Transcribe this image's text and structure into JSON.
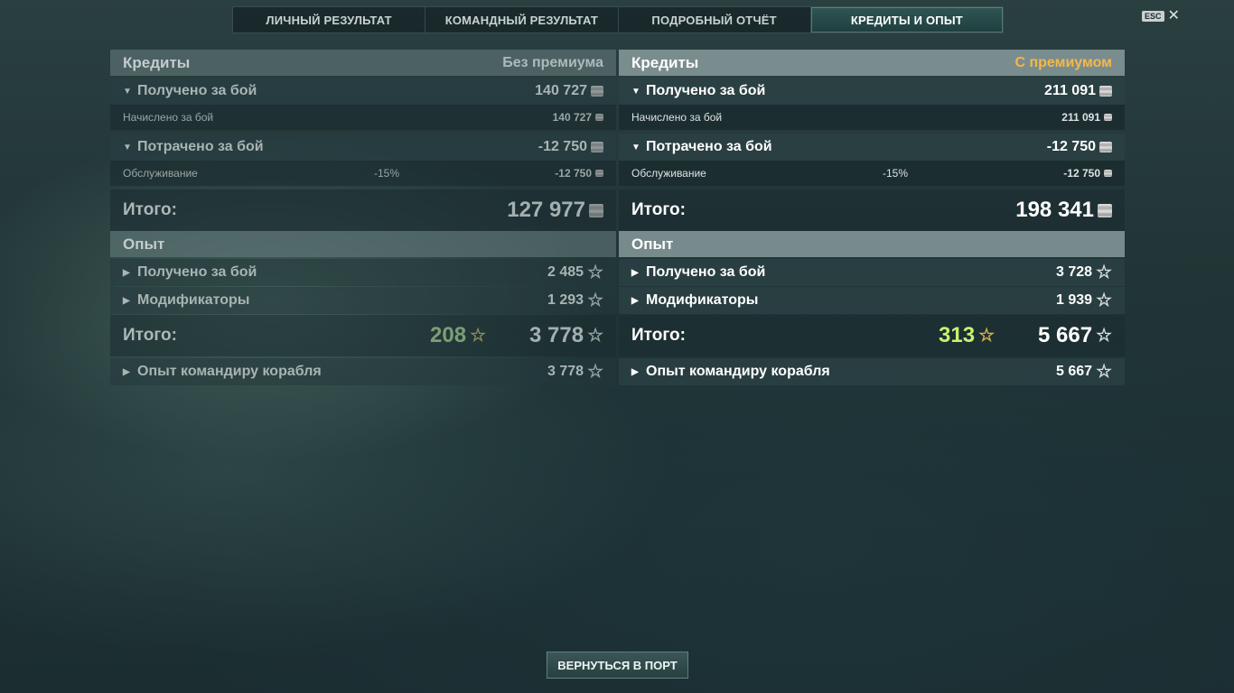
{
  "tabs": [
    "ЛИЧНЫЙ РЕЗУЛЬТАТ",
    "КОМАНДНЫЙ РЕЗУЛЬТАТ",
    "ПОДРОБНЫЙ ОТЧЁТ",
    "КРЕДИТЫ И ОПЫТ"
  ],
  "active_tab": "КРЕДИТЫ И ОПЫТ",
  "esc": {
    "key": "ESC",
    "close": "✕"
  },
  "accent_colors": {
    "premium": "#f5b74a",
    "bonus_xp": "#c9f06f"
  },
  "panels": {
    "left": {
      "credits_title": "Кредиты",
      "mode": "Без премиума",
      "earned_label": "Получено за бой",
      "earned_value": "140 727",
      "accrued_label": "Начислено за бой",
      "accrued_value": "140 727",
      "spent_label": "Потрачено за бой",
      "spent_value": "-12 750",
      "service_label": "Обслуживание",
      "service_pct": "-15%",
      "service_value": "-12 750",
      "total_label": "Итого:",
      "total_value": "127 977",
      "xp_title": "Опыт",
      "xp_earned_label": "Получено за бой",
      "xp_earned_value": "2 485",
      "modifiers_label": "Модификаторы",
      "modifiers_value": "1 293",
      "xp_total_label": "Итого:",
      "xp_bonus": "208",
      "xp_total": "3 778",
      "commander_label": "Опыт командиру корабля",
      "commander_value": "3 778"
    },
    "right": {
      "credits_title": "Кредиты",
      "mode": "С премиумом",
      "earned_label": "Получено за бой",
      "earned_value": "211 091",
      "accrued_label": "Начислено за бой",
      "accrued_value": "211 091",
      "spent_label": "Потрачено за бой",
      "spent_value": "-12 750",
      "service_label": "Обслуживание",
      "service_pct": "-15%",
      "service_value": "-12 750",
      "total_label": "Итого:",
      "total_value": "198 341",
      "xp_title": "Опыт",
      "xp_earned_label": "Получено за бой",
      "xp_earned_value": "3 728",
      "modifiers_label": "Модификаторы",
      "modifiers_value": "1 939",
      "xp_total_label": "Итого:",
      "xp_bonus": "313",
      "xp_total": "5 667",
      "commander_label": "Опыт командиру корабля",
      "commander_value": "5 667"
    }
  },
  "back_button": "ВЕРНУТЬСЯ В ПОРТ"
}
